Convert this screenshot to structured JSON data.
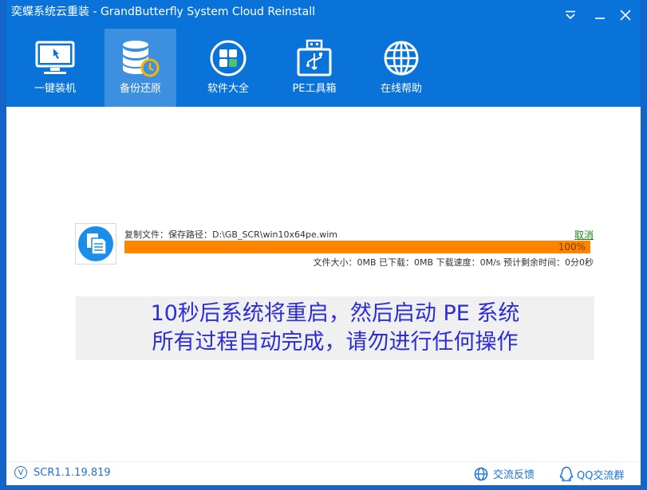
{
  "window": {
    "title": "奕蝶系统云重装 - GrandButterfly System Cloud Reinstall"
  },
  "nav": {
    "items": [
      {
        "label": "一键装机",
        "icon": "monitor-click-icon",
        "active": false
      },
      {
        "label": "备份还原",
        "icon": "database-restore-icon",
        "active": true
      },
      {
        "label": "软件大全",
        "icon": "apps-grid-icon",
        "active": false
      },
      {
        "label": "PE工具箱",
        "icon": "usb-toolbox-icon",
        "active": false
      },
      {
        "label": "在线帮助",
        "icon": "globe-icon",
        "active": false
      }
    ]
  },
  "progress": {
    "file_label": "复制文件：保存路径：D:\\GB_SCR\\win10x64pe.wim",
    "cancel_label": "取消",
    "percent": 1.0,
    "percent_text": "100%",
    "stats_text": "文件大小：0MB   已下载：0MB   下载速度：0M/s   预计剩余时间：0分0秒"
  },
  "notice": {
    "line1": "10秒后系统将重启，然后启动 PE 系统",
    "line2": "所有过程自动完成，请勿进行任何操作"
  },
  "statusbar": {
    "version": "SCR1.1.19.819",
    "version_icon": "V",
    "feedback_label": "交流反馈",
    "qq_label": "QQ交流群"
  },
  "colors": {
    "brand_blue": "#0a73d9",
    "active_tab": "#3d8fe0",
    "progress_orange": "#ff8400",
    "notice_text": "#2d2dd6",
    "cancel_green": "#1a8a1a"
  }
}
